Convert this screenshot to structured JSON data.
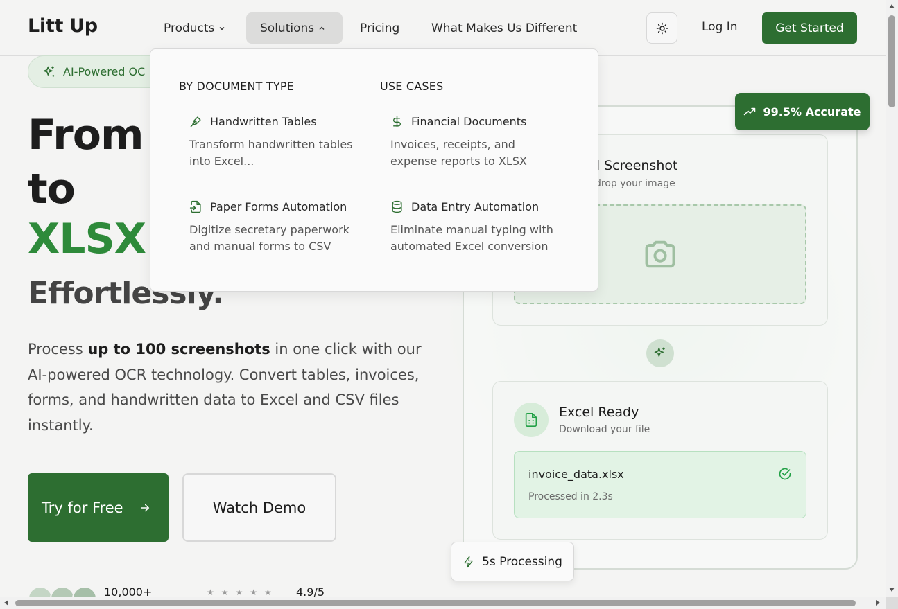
{
  "header": {
    "logo": "Litt Up",
    "nav": {
      "products": "Products",
      "solutions": "Solutions",
      "pricing": "Pricing",
      "different": "What Makes Us Different"
    },
    "login": "Log In",
    "get_started": "Get Started"
  },
  "hero": {
    "badge": "AI-Powered OC",
    "line1": "From I",
    "line2": "to",
    "line3": "XLSX I",
    "line4": "Effortlessly.",
    "desc_pre": "Process ",
    "desc_bold": "up to 100 screenshots",
    "desc_post": " in one click with our AI-powered OCR technology. Convert tables, invoices, forms, and handwritten data to Excel and CSV files instantly.",
    "try_free": "Try for Free",
    "watch_demo": "Watch Demo",
    "users": "10,000+",
    "rating": "4.9/5",
    "stars": "★★★★★"
  },
  "dropdown": {
    "col1_heading": "BY DOCUMENT TYPE",
    "col2_heading": "USE CASES",
    "items": [
      {
        "title": "Handwritten Tables",
        "desc": "Transform handwritten tables into Excel...",
        "icon": "pen-tool-icon"
      },
      {
        "title": "Paper Forms Automation",
        "desc": "Digitize secretary paperwork and manual forms to CSV",
        "icon": "file-input-icon"
      },
      {
        "title": "Financial Documents",
        "desc": "Invoices, receipts, and expense reports to XLSX",
        "icon": "dollar-icon"
      },
      {
        "title": "Data Entry Automation",
        "desc": "Eliminate manual typing with automated Excel conversion",
        "icon": "database-icon"
      }
    ]
  },
  "demo_card": {
    "upload_title": "d Screenshot",
    "upload_sub": "drop your image",
    "excel_title": "Excel Ready",
    "excel_sub": "Download your file",
    "file_name": "invoice_data.xlsx",
    "file_time": "Processed in 2.3s",
    "accurate": "99.5% Accurate",
    "processing": "5s Processing"
  },
  "colors": {
    "brand_green": "#2d6e31",
    "headline_green": "#2e8a3a",
    "background": "#f4f4f3"
  }
}
